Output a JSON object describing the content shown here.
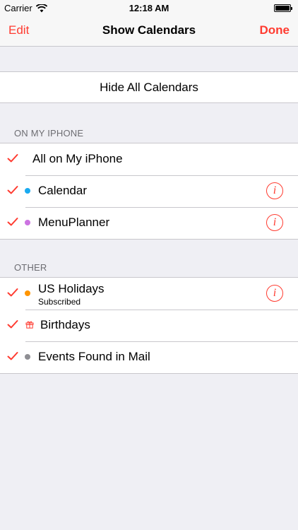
{
  "status_bar": {
    "carrier": "Carrier",
    "time": "12:18 AM",
    "icons": [
      "wifi-icon",
      "battery-icon"
    ]
  },
  "nav": {
    "left": "Edit",
    "title": "Show Calendars",
    "right": "Done"
  },
  "hide_all": "Hide All Calendars",
  "sections": {
    "iphone": {
      "header": "ON MY IPHONE",
      "rows": [
        {
          "label": "All on My iPhone"
        },
        {
          "label": "Calendar",
          "dot_color": "#1aaaf0",
          "info": "i"
        },
        {
          "label": "MenuPlanner",
          "dot_color": "#cc73e1",
          "info": "i"
        }
      ]
    },
    "other": {
      "header": "OTHER",
      "rows": [
        {
          "label": "US Holidays",
          "sub": "Subscribed",
          "dot_color": "#ff9500",
          "info": "i"
        },
        {
          "label": "Birthdays",
          "icon": "gift-icon"
        },
        {
          "label": "Events Found in Mail",
          "dot_color": "#8e8e93"
        }
      ]
    }
  },
  "colors": {
    "accent": "#ff3b30",
    "background": "#efeff4",
    "separator": "#c8c7cc"
  }
}
